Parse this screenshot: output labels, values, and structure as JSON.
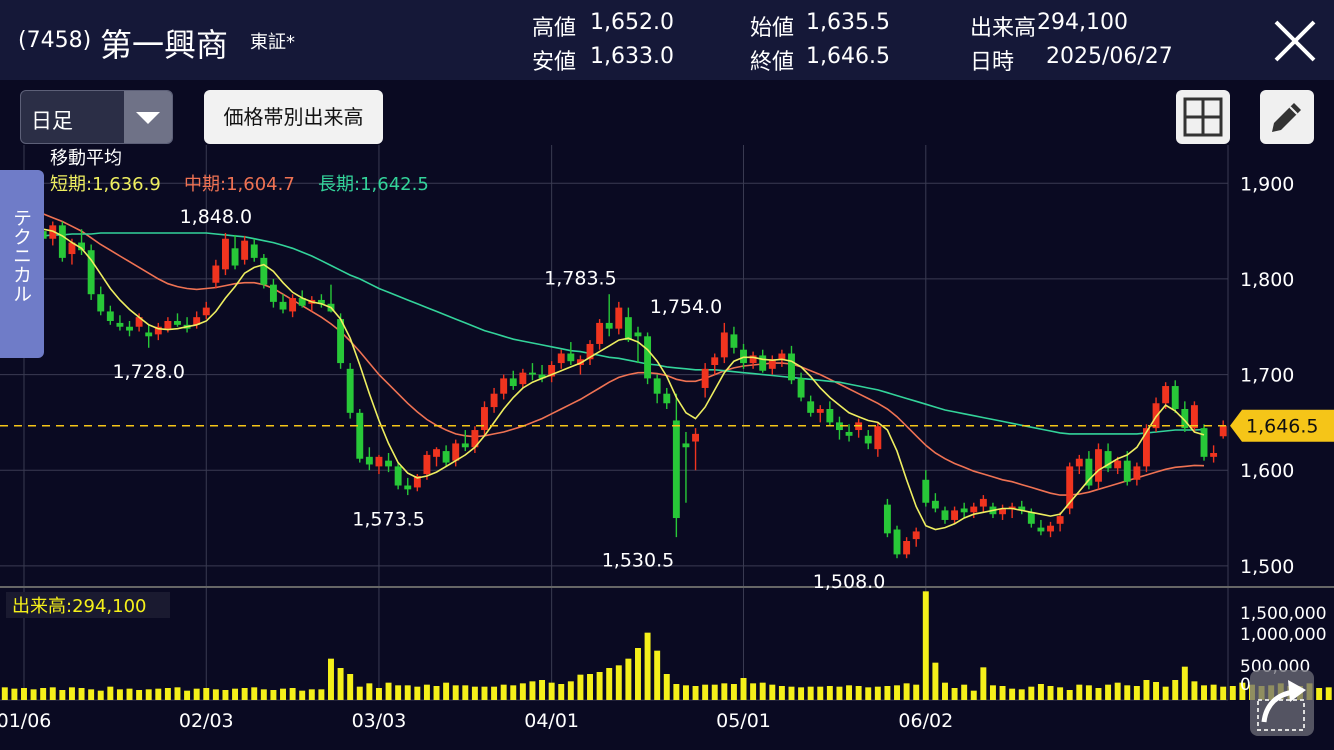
{
  "header": {
    "code": "(7458)",
    "name": "第一興商",
    "market": "東証*",
    "high_label": "高値",
    "high": "1,652.0",
    "low_label": "安値",
    "low": "1,633.0",
    "open_label": "始値",
    "open": "1,635.5",
    "close_label": "終値",
    "close": "1,646.5",
    "volume_label": "出来高",
    "volume": "294,100",
    "date_label": "日時",
    "date": "2025/06/27"
  },
  "toolbar": {
    "period_value": "日足",
    "volume_profile_label": "価格帯別出来高"
  },
  "side_tab": {
    "label": "テクニカル"
  },
  "indicators": {
    "ma_title": "移動平均",
    "short_text": "短期:1,636.9",
    "mid_text": "中期:1,604.7",
    "long_text": "長期:1,642.5",
    "volume_text": "出来高:294,100"
  },
  "colors": {
    "up": "#f0341f",
    "down": "#28c838",
    "ma_short": "#eeee60",
    "ma_mid": "#ef7253",
    "ma_long": "#33d39a",
    "volume": "#f5f01a",
    "current_price": "#f5c518"
  },
  "chart_data": {
    "type": "candlestick",
    "price_axis": {
      "min": 1480,
      "max": 1940,
      "ticks": [
        1500,
        1600,
        1700,
        1800,
        1900
      ]
    },
    "price_tick_labels": [
      "1,500",
      "1,600",
      "1,700",
      "1,800",
      "1,900"
    ],
    "volume_axis": {
      "min": 0,
      "max": 1650000,
      "ticks": [
        0,
        500000,
        1000000,
        1500000
      ]
    },
    "volume_tick_labels": [
      "0",
      "500,000",
      "1,000,000",
      "1,500,000"
    ],
    "x_tick_labels": [
      {
        "label": "01/06",
        "index": 2
      },
      {
        "label": "02/03",
        "index": 21
      },
      {
        "label": "03/03",
        "index": 39
      },
      {
        "label": "04/01",
        "index": 57
      },
      {
        "label": "05/01",
        "index": 77
      },
      {
        "label": "06/02",
        "index": 96
      }
    ],
    "current_price": {
      "value": 1646.5,
      "label": "1,646.5"
    },
    "annotations": [
      {
        "label": "1,848.0",
        "index": 22,
        "value": 1848.0,
        "pos": "above"
      },
      {
        "label": "1,728.0",
        "index": 15,
        "value": 1728.0,
        "pos": "below"
      },
      {
        "label": "1,573.5",
        "index": 40,
        "value": 1573.5,
        "pos": "below"
      },
      {
        "label": "1,783.5",
        "index": 60,
        "value": 1783.5,
        "pos": "above"
      },
      {
        "label": "1,530.5",
        "index": 66,
        "value": 1530.5,
        "pos": "below"
      },
      {
        "label": "1,754.0",
        "index": 71,
        "value": 1754.0,
        "pos": "above"
      },
      {
        "label": "1,508.0",
        "index": 88,
        "value": 1508.0,
        "pos": "below"
      }
    ],
    "ohlc": [
      [
        1876,
        1880,
        1852,
        1856
      ],
      [
        1856,
        1870,
        1845,
        1864
      ],
      [
        1862,
        1878,
        1848,
        1855
      ],
      [
        1855,
        1862,
        1845,
        1850
      ],
      [
        1850,
        1858,
        1840,
        1842
      ],
      [
        1842,
        1860,
        1835,
        1856
      ],
      [
        1856,
        1860,
        1818,
        1822
      ],
      [
        1826,
        1842,
        1815,
        1838
      ],
      [
        1838,
        1852,
        1825,
        1830
      ],
      [
        1830,
        1836,
        1778,
        1784
      ],
      [
        1784,
        1792,
        1762,
        1766
      ],
      [
        1766,
        1772,
        1752,
        1756
      ],
      [
        1754,
        1762,
        1746,
        1750
      ],
      [
        1750,
        1756,
        1740,
        1746
      ],
      [
        1750,
        1764,
        1745,
        1760
      ],
      [
        1744,
        1752,
        1728,
        1740
      ],
      [
        1742,
        1754,
        1736,
        1750
      ],
      [
        1748,
        1760,
        1744,
        1756
      ],
      [
        1756,
        1764,
        1750,
        1752
      ],
      [
        1752,
        1760,
        1744,
        1748
      ],
      [
        1752,
        1766,
        1748,
        1760
      ],
      [
        1762,
        1776,
        1758,
        1770
      ],
      [
        1796,
        1820,
        1790,
        1814
      ],
      [
        1810,
        1848,
        1804,
        1842
      ],
      [
        1832,
        1846,
        1810,
        1814
      ],
      [
        1820,
        1845,
        1815,
        1840
      ],
      [
        1836,
        1842,
        1818,
        1822
      ],
      [
        1822,
        1826,
        1790,
        1794
      ],
      [
        1794,
        1800,
        1770,
        1776
      ],
      [
        1776,
        1784,
        1764,
        1768
      ],
      [
        1766,
        1784,
        1760,
        1780
      ],
      [
        1780,
        1788,
        1770,
        1772
      ],
      [
        1774,
        1782,
        1766,
        1778
      ],
      [
        1778,
        1784,
        1770,
        1774
      ],
      [
        1774,
        1794,
        1765,
        1766
      ],
      [
        1758,
        1764,
        1706,
        1712
      ],
      [
        1706,
        1712,
        1654,
        1660
      ],
      [
        1660,
        1664,
        1608,
        1612
      ],
      [
        1614,
        1624,
        1600,
        1606
      ],
      [
        1604,
        1616,
        1596,
        1614
      ],
      [
        1610,
        1618,
        1598,
        1604
      ],
      [
        1604,
        1608,
        1580,
        1584
      ],
      [
        1584,
        1592,
        1574,
        1580
      ],
      [
        1582,
        1596,
        1578,
        1594
      ],
      [
        1596,
        1620,
        1590,
        1616
      ],
      [
        1614,
        1624,
        1604,
        1622
      ],
      [
        1620,
        1626,
        1604,
        1608
      ],
      [
        1610,
        1632,
        1604,
        1628
      ],
      [
        1628,
        1642,
        1620,
        1624
      ],
      [
        1624,
        1646,
        1618,
        1642
      ],
      [
        1642,
        1672,
        1636,
        1666
      ],
      [
        1666,
        1686,
        1660,
        1680
      ],
      [
        1680,
        1700,
        1674,
        1696
      ],
      [
        1696,
        1704,
        1684,
        1688
      ],
      [
        1690,
        1706,
        1686,
        1702
      ],
      [
        1702,
        1712,
        1694,
        1700
      ],
      [
        1700,
        1710,
        1692,
        1696
      ],
      [
        1698,
        1714,
        1692,
        1710
      ],
      [
        1712,
        1726,
        1706,
        1722
      ],
      [
        1722,
        1734,
        1710,
        1714
      ],
      [
        1710,
        1720,
        1700,
        1716
      ],
      [
        1716,
        1736,
        1710,
        1732
      ],
      [
        1732,
        1758,
        1726,
        1754
      ],
      [
        1754,
        1784,
        1740,
        1748
      ],
      [
        1748,
        1776,
        1742,
        1770
      ],
      [
        1760,
        1770,
        1734,
        1736
      ],
      [
        1744,
        1750,
        1712,
        1740
      ],
      [
        1740,
        1744,
        1690,
        1696
      ],
      [
        1696,
        1700,
        1670,
        1680
      ],
      [
        1680,
        1686,
        1664,
        1670
      ],
      [
        1652,
        1680,
        1530,
        1550
      ],
      [
        1628,
        1640,
        1566,
        1624
      ],
      [
        1630,
        1644,
        1600,
        1638
      ],
      [
        1686,
        1712,
        1676,
        1706
      ],
      [
        1710,
        1722,
        1700,
        1718
      ],
      [
        1718,
        1754,
        1712,
        1744
      ],
      [
        1742,
        1750,
        1722,
        1728
      ],
      [
        1726,
        1732,
        1706,
        1712
      ],
      [
        1712,
        1724,
        1706,
        1720
      ],
      [
        1720,
        1726,
        1702,
        1704
      ],
      [
        1706,
        1720,
        1700,
        1716
      ],
      [
        1716,
        1726,
        1708,
        1722
      ],
      [
        1722,
        1730,
        1690,
        1694
      ],
      [
        1696,
        1702,
        1672,
        1676
      ],
      [
        1672,
        1678,
        1656,
        1660
      ],
      [
        1660,
        1668,
        1650,
        1664
      ],
      [
        1664,
        1672,
        1646,
        1650
      ],
      [
        1650,
        1656,
        1632,
        1642
      ],
      [
        1640,
        1648,
        1630,
        1636
      ],
      [
        1642,
        1654,
        1634,
        1650
      ],
      [
        1636,
        1642,
        1622,
        1628
      ],
      [
        1622,
        1650,
        1614,
        1646
      ],
      [
        1564,
        1570,
        1530,
        1534
      ],
      [
        1538,
        1542,
        1508,
        1512
      ],
      [
        1512,
        1530,
        1508,
        1526
      ],
      [
        1528,
        1540,
        1520,
        1536
      ],
      [
        1590,
        1600,
        1562,
        1566
      ],
      [
        1568,
        1576,
        1556,
        1560
      ],
      [
        1558,
        1562,
        1544,
        1548
      ],
      [
        1548,
        1562,
        1544,
        1558
      ],
      [
        1560,
        1566,
        1550,
        1556
      ],
      [
        1556,
        1566,
        1550,
        1562
      ],
      [
        1562,
        1574,
        1556,
        1570
      ],
      [
        1562,
        1566,
        1550,
        1554
      ],
      [
        1554,
        1564,
        1548,
        1560
      ],
      [
        1560,
        1566,
        1550,
        1562
      ],
      [
        1562,
        1568,
        1554,
        1558
      ],
      [
        1556,
        1560,
        1540,
        1544
      ],
      [
        1540,
        1548,
        1532,
        1536
      ],
      [
        1536,
        1546,
        1530,
        1542
      ],
      [
        1544,
        1556,
        1536,
        1552
      ],
      [
        1560,
        1608,
        1554,
        1604
      ],
      [
        1604,
        1616,
        1596,
        1612
      ],
      [
        1612,
        1620,
        1580,
        1584
      ],
      [
        1588,
        1628,
        1580,
        1622
      ],
      [
        1620,
        1628,
        1598,
        1602
      ],
      [
        1602,
        1614,
        1596,
        1610
      ],
      [
        1610,
        1620,
        1584,
        1588
      ],
      [
        1590,
        1608,
        1584,
        1604
      ],
      [
        1604,
        1648,
        1598,
        1644
      ],
      [
        1644,
        1676,
        1640,
        1670
      ],
      [
        1670,
        1692,
        1664,
        1688
      ],
      [
        1688,
        1694,
        1660,
        1664
      ],
      [
        1664,
        1672,
        1640,
        1644
      ],
      [
        1644,
        1672,
        1640,
        1668
      ],
      [
        1644,
        1648,
        1610,
        1614
      ],
      [
        1614,
        1626,
        1608,
        1618
      ],
      [
        1635.5,
        1652,
        1633,
        1646.5
      ]
    ],
    "ma_short": [
      1860,
      1858,
      1856,
      1855,
      1852,
      1850,
      1845,
      1838,
      1832,
      1820,
      1805,
      1790,
      1778,
      1768,
      1760,
      1752,
      1748,
      1747,
      1748,
      1750,
      1752,
      1756,
      1766,
      1780,
      1792,
      1806,
      1812,
      1815,
      1808,
      1796,
      1786,
      1780,
      1776,
      1774,
      1770,
      1758,
      1738,
      1710,
      1680,
      1652,
      1628,
      1608,
      1597,
      1592,
      1594,
      1598,
      1604,
      1610,
      1616,
      1624,
      1636,
      1650,
      1664,
      1676,
      1686,
      1692,
      1696,
      1700,
      1704,
      1708,
      1712,
      1718,
      1724,
      1730,
      1736,
      1738,
      1734,
      1726,
      1714,
      1698,
      1676,
      1660,
      1654,
      1666,
      1684,
      1702,
      1714,
      1718,
      1718,
      1716,
      1715,
      1716,
      1714,
      1708,
      1698,
      1686,
      1676,
      1668,
      1660,
      1656,
      1652,
      1650,
      1642,
      1620,
      1590,
      1562,
      1542,
      1538,
      1540,
      1544,
      1550,
      1554,
      1556,
      1558,
      1560,
      1560,
      1558,
      1556,
      1554,
      1552,
      1554,
      1566,
      1578,
      1590,
      1600,
      1606,
      1612,
      1616,
      1624,
      1640,
      1656,
      1668,
      1662,
      1652,
      1640,
      1636.9
    ],
    "ma_mid": [
      1880,
      1878,
      1875,
      1872,
      1868,
      1864,
      1860,
      1855,
      1850,
      1843,
      1836,
      1830,
      1824,
      1818,
      1812,
      1806,
      1800,
      1795,
      1792,
      1790,
      1789,
      1790,
      1791,
      1793,
      1795,
      1796,
      1796,
      1794,
      1790,
      1784,
      1778,
      1772,
      1766,
      1760,
      1753,
      1745,
      1735,
      1724,
      1712,
      1700,
      1690,
      1680,
      1670,
      1661,
      1653,
      1647,
      1642,
      1638,
      1636,
      1635,
      1636,
      1638,
      1640,
      1643,
      1646,
      1650,
      1654,
      1659,
      1664,
      1669,
      1674,
      1680,
      1686,
      1692,
      1697,
      1700,
      1702,
      1702,
      1701,
      1699,
      1695,
      1693,
      1693,
      1696,
      1700,
      1704,
      1707,
      1709,
      1710,
      1711,
      1712,
      1712,
      1711,
      1708,
      1704,
      1700,
      1695,
      1690,
      1685,
      1680,
      1675,
      1670,
      1664,
      1656,
      1646,
      1636,
      1626,
      1618,
      1612,
      1607,
      1603,
      1599,
      1596,
      1593,
      1590,
      1588,
      1585,
      1582,
      1579,
      1576,
      1574,
      1574,
      1575,
      1577,
      1580,
      1583,
      1586,
      1589,
      1592,
      1595,
      1598,
      1601,
      1603,
      1604,
      1605,
      1604.7
    ],
    "ma_long": [
      1842,
      1843,
      1844,
      1845,
      1845,
      1846,
      1846,
      1847,
      1847,
      1847,
      1848,
      1848,
      1848,
      1848,
      1848,
      1848,
      1848,
      1848,
      1848,
      1848,
      1848,
      1848,
      1847,
      1846,
      1845,
      1844,
      1842,
      1840,
      1838,
      1835,
      1832,
      1828,
      1824,
      1819,
      1814,
      1809,
      1804,
      1800,
      1795,
      1790,
      1786,
      1782,
      1778,
      1774,
      1770,
      1766,
      1762,
      1758,
      1754,
      1750,
      1746,
      1743,
      1740,
      1737,
      1735,
      1733,
      1731,
      1729,
      1727,
      1725,
      1724,
      1722,
      1720,
      1718,
      1717,
      1715,
      1713,
      1711,
      1710,
      1708,
      1707,
      1706,
      1705,
      1705,
      1705,
      1704,
      1703,
      1702,
      1701,
      1700,
      1699,
      1698,
      1697,
      1696,
      1695,
      1694,
      1693,
      1692,
      1690,
      1688,
      1686,
      1684,
      1681,
      1678,
      1675,
      1672,
      1669,
      1666,
      1663,
      1661,
      1659,
      1657,
      1655,
      1653,
      1651,
      1649,
      1647,
      1645,
      1643,
      1641,
      1639,
      1638,
      1638,
      1638,
      1638,
      1638,
      1638,
      1638,
      1638,
      1639,
      1640,
      1641,
      1642,
      1642,
      1642,
      1642.5
    ],
    "volume": [
      190000,
      170000,
      180000,
      160000,
      180000,
      190000,
      150000,
      190000,
      180000,
      160000,
      140000,
      200000,
      160000,
      170000,
      150000,
      160000,
      170000,
      180000,
      190000,
      140000,
      170000,
      180000,
      160000,
      150000,
      170000,
      180000,
      190000,
      160000,
      150000,
      170000,
      180000,
      140000,
      160000,
      160000,
      620000,
      480000,
      390000,
      200000,
      250000,
      180000,
      260000,
      220000,
      220000,
      200000,
      230000,
      210000,
      260000,
      220000,
      220000,
      200000,
      200000,
      200000,
      230000,
      220000,
      250000,
      280000,
      300000,
      260000,
      240000,
      280000,
      380000,
      390000,
      420000,
      480000,
      520000,
      620000,
      780000,
      1010000,
      740000,
      390000,
      240000,
      220000,
      210000,
      230000,
      230000,
      250000,
      240000,
      330000,
      250000,
      260000,
      230000,
      210000,
      200000,
      190000,
      200000,
      200000,
      210000,
      200000,
      220000,
      210000,
      190000,
      200000,
      210000,
      220000,
      250000,
      230000,
      1630000,
      560000,
      260000,
      180000,
      230000,
      140000,
      490000,
      220000,
      210000,
      170000,
      160000,
      200000,
      240000,
      210000,
      190000,
      150000,
      230000,
      220000,
      180000,
      230000,
      260000,
      220000,
      210000,
      300000,
      270000,
      200000,
      300000,
      500000,
      280000,
      220000,
      230000,
      200000,
      210000,
      260000,
      230000,
      210000,
      220000,
      250000,
      210000,
      210000,
      250000,
      180000,
      190000,
      310000,
      190000,
      190000,
      150000,
      200000,
      180000,
      294100
    ]
  }
}
